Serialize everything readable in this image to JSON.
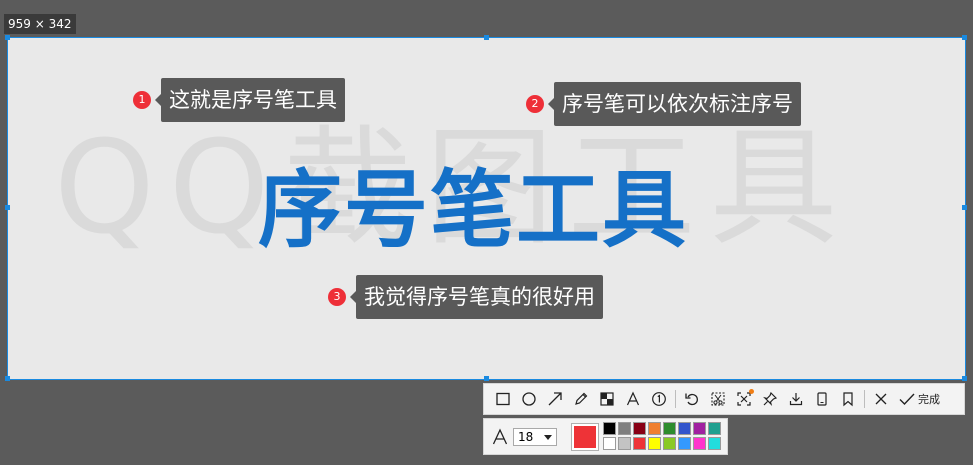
{
  "selection": {
    "size_label": "959 × 342"
  },
  "canvas": {
    "watermark": "QQ截图工具",
    "title": "序号笔工具",
    "markers": [
      {
        "number": "1",
        "text": "这就是序号笔工具"
      },
      {
        "number": "2",
        "text": "序号笔可以依次标注序号"
      },
      {
        "number": "3",
        "text": "我觉得序号笔真的很好用"
      }
    ]
  },
  "toolbar": {
    "tools": [
      "rectangle-icon",
      "ellipse-icon",
      "arrow-icon",
      "pencil-icon",
      "mosaic-icon",
      "text-icon",
      "sequence-number-icon",
      "undo-icon",
      "cutout-icon",
      "screen-recognition-icon",
      "pin-icon",
      "download-icon",
      "device-icon",
      "bookmark-icon",
      "close-icon"
    ],
    "done_label": "完成"
  },
  "properties": {
    "font_size": "18",
    "current_color": "#ee3337",
    "palette": [
      "#000000",
      "#7f7f7f",
      "#880015",
      "#f08030",
      "#2d8c2d",
      "#3355cc",
      "#a020a0",
      "#20a090",
      "#ffffff",
      "#c3c3c3",
      "#ee3337",
      "#ffff00",
      "#8ac926",
      "#3399ff",
      "#ff33cc",
      "#22dddd"
    ]
  }
}
